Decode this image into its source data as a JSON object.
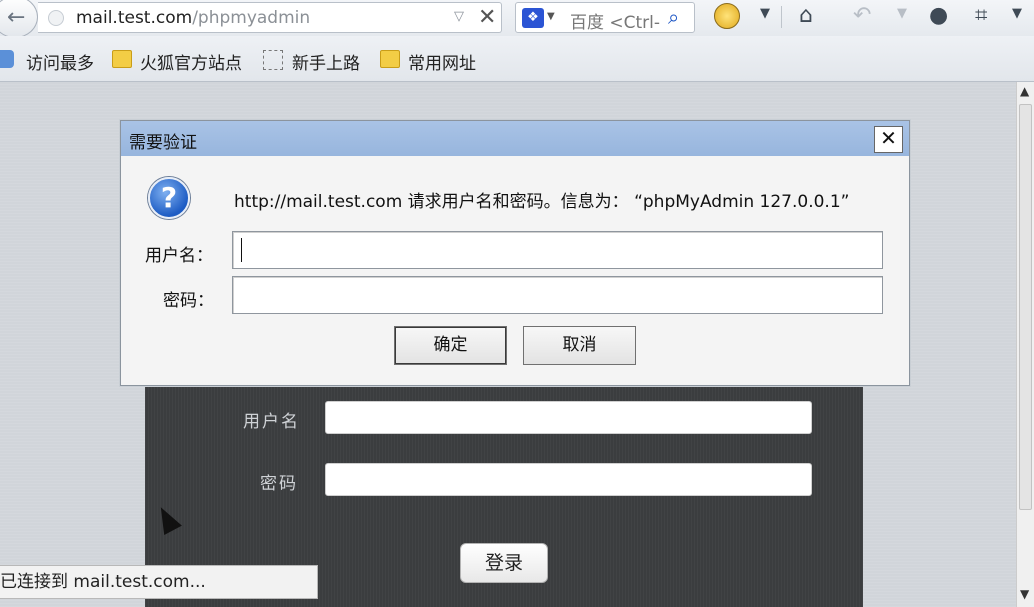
{
  "browser": {
    "url_host": "mail.test.com",
    "url_path": "/phpmyadmin",
    "search_engine": "百度",
    "search_placeholder": "<Ctrl-"
  },
  "bookmarks": [
    {
      "label": "访问最多"
    },
    {
      "label": "火狐官方站点"
    },
    {
      "label": "新手上路"
    },
    {
      "label": "常用网址"
    }
  ],
  "dialog": {
    "title": "需要验证",
    "message": "http://mail.test.com 请求用户名和密码。信息为：  “phpMyAdmin 127.0.0.1”",
    "username_label": "用户名：",
    "password_label": "密码：",
    "ok_label": "确定",
    "cancel_label": "取消"
  },
  "login": {
    "username_label": "用户名",
    "password_label": "密码",
    "submit_label": "登录"
  },
  "status": "已连接到 mail.test.com..."
}
